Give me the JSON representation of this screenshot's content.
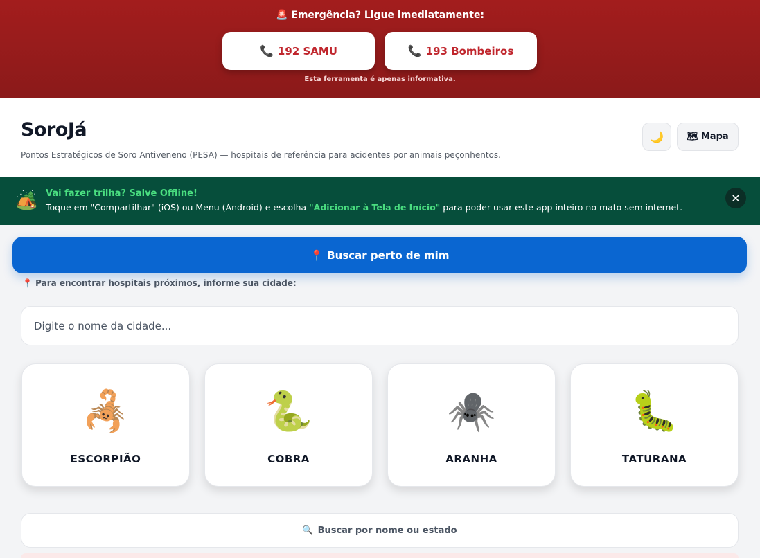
{
  "emergency": {
    "title": "🚨 Emergência? Ligue imediatamente:",
    "samu_label": "192 SAMU",
    "bombeiros_label": "193 Bombeiros",
    "note": "Esta ferramenta é apenas informativa.",
    "phone_icon": "📞",
    "accent": "#c0262d",
    "background": "#8b1a1a"
  },
  "header": {
    "brand": "SoroJá",
    "subtitle": "Pontos Estratégicos de Soro Antiveneno (PESA) — hospitais de referência para acidentes por animais peçonhentos.",
    "theme_icon": "🌙",
    "map_icon": "🗺",
    "map_label": "Mapa"
  },
  "offline_banner": {
    "icon": "🏕️",
    "title": "Vai fazer trilha? Salve Offline!",
    "text_before": "Toque em \"Compartilhar\" (iOS) ou Menu (Android) e escolha ",
    "highlight": "\"Adicionar à Tela de Início\"",
    "text_after": " para poder usar este app inteiro no mato sem internet.",
    "close_icon": "✕",
    "background": "#064e3b",
    "accent": "#4ade80"
  },
  "search": {
    "near_me_icon": "📍",
    "near_me_label": "Buscar perto de mim",
    "hint_icon": "📍",
    "hint": "Para encontrar hospitais próximos, informe sua cidade:",
    "city_placeholder": "Digite o nome da cidade...",
    "by_name_icon": "🔍",
    "by_name_label": "Buscar por nome ou estado",
    "primary_color": "#0a66d1"
  },
  "animals": [
    {
      "emoji": "🦂",
      "label": "ESCORPIÃO"
    },
    {
      "emoji": "🐍",
      "label": "COBRA"
    },
    {
      "emoji": "🕷️",
      "label": "ARANHA"
    },
    {
      "emoji": "🐛",
      "label": "TATURANA"
    }
  ]
}
